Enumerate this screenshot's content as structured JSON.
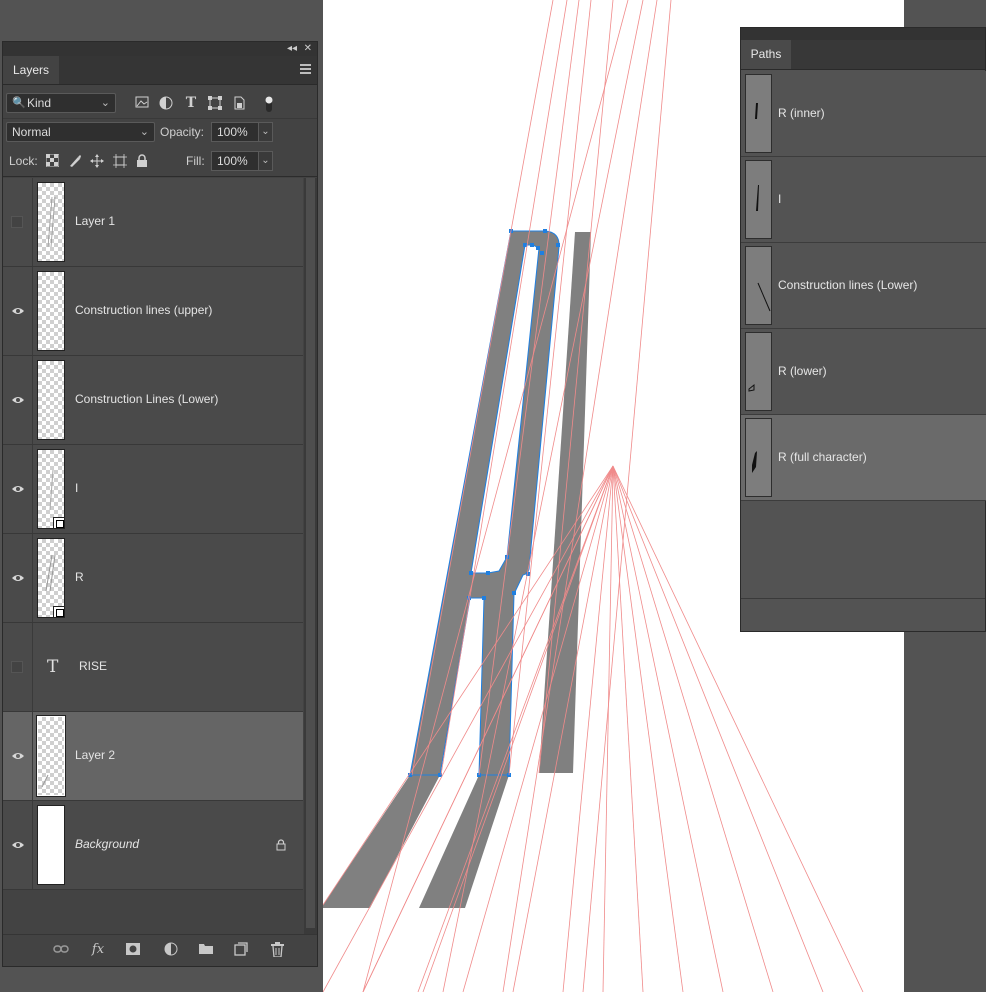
{
  "colors": {
    "workspace": "#535353",
    "canvas": "#ffffff",
    "shape_fill": "#808080",
    "path_selection": "#1f7fe0",
    "construction_lines": "#f08a8a"
  },
  "layers_panel": {
    "tab": "Layers",
    "filter": {
      "label": "Kind",
      "icons": [
        "image-filter-icon",
        "adjustment-filter-icon",
        "type-filter-icon",
        "shape-filter-icon",
        "smart-object-filter-icon",
        "filter-toggle-icon"
      ]
    },
    "blend_mode": "Normal",
    "opacity_label": "Opacity:",
    "opacity_value": "100%",
    "lock_label": "Lock:",
    "fill_label": "Fill:",
    "fill_value": "100%",
    "layers": [
      {
        "name": "Layer 1",
        "visible": false,
        "kind": "pixel"
      },
      {
        "name": "Construction lines (upper)",
        "visible": true,
        "kind": "pixel"
      },
      {
        "name": "Construction Lines (Lower)",
        "visible": true,
        "kind": "pixel"
      },
      {
        "name": "I",
        "visible": true,
        "kind": "shape"
      },
      {
        "name": "R",
        "visible": true,
        "kind": "shape"
      },
      {
        "name": "RISE",
        "visible": false,
        "kind": "type",
        "type_glyph": "T"
      },
      {
        "name": "Layer 2",
        "visible": true,
        "kind": "pixel",
        "selected": true
      },
      {
        "name": "Background",
        "visible": true,
        "kind": "background",
        "locked": true
      }
    ],
    "bottom_icons": [
      "link-icon",
      "fx-icon",
      "mask-icon",
      "adjustment-icon",
      "folder-icon",
      "new-layer-icon",
      "trash-icon"
    ],
    "fx_label": "fx"
  },
  "paths_panel": {
    "tab": "Paths",
    "paths": [
      {
        "name": "R (inner)"
      },
      {
        "name": "I"
      },
      {
        "name": "Construction lines (Lower)"
      },
      {
        "name": "R (lower)"
      },
      {
        "name": "R (full character)",
        "selected": true
      }
    ]
  }
}
